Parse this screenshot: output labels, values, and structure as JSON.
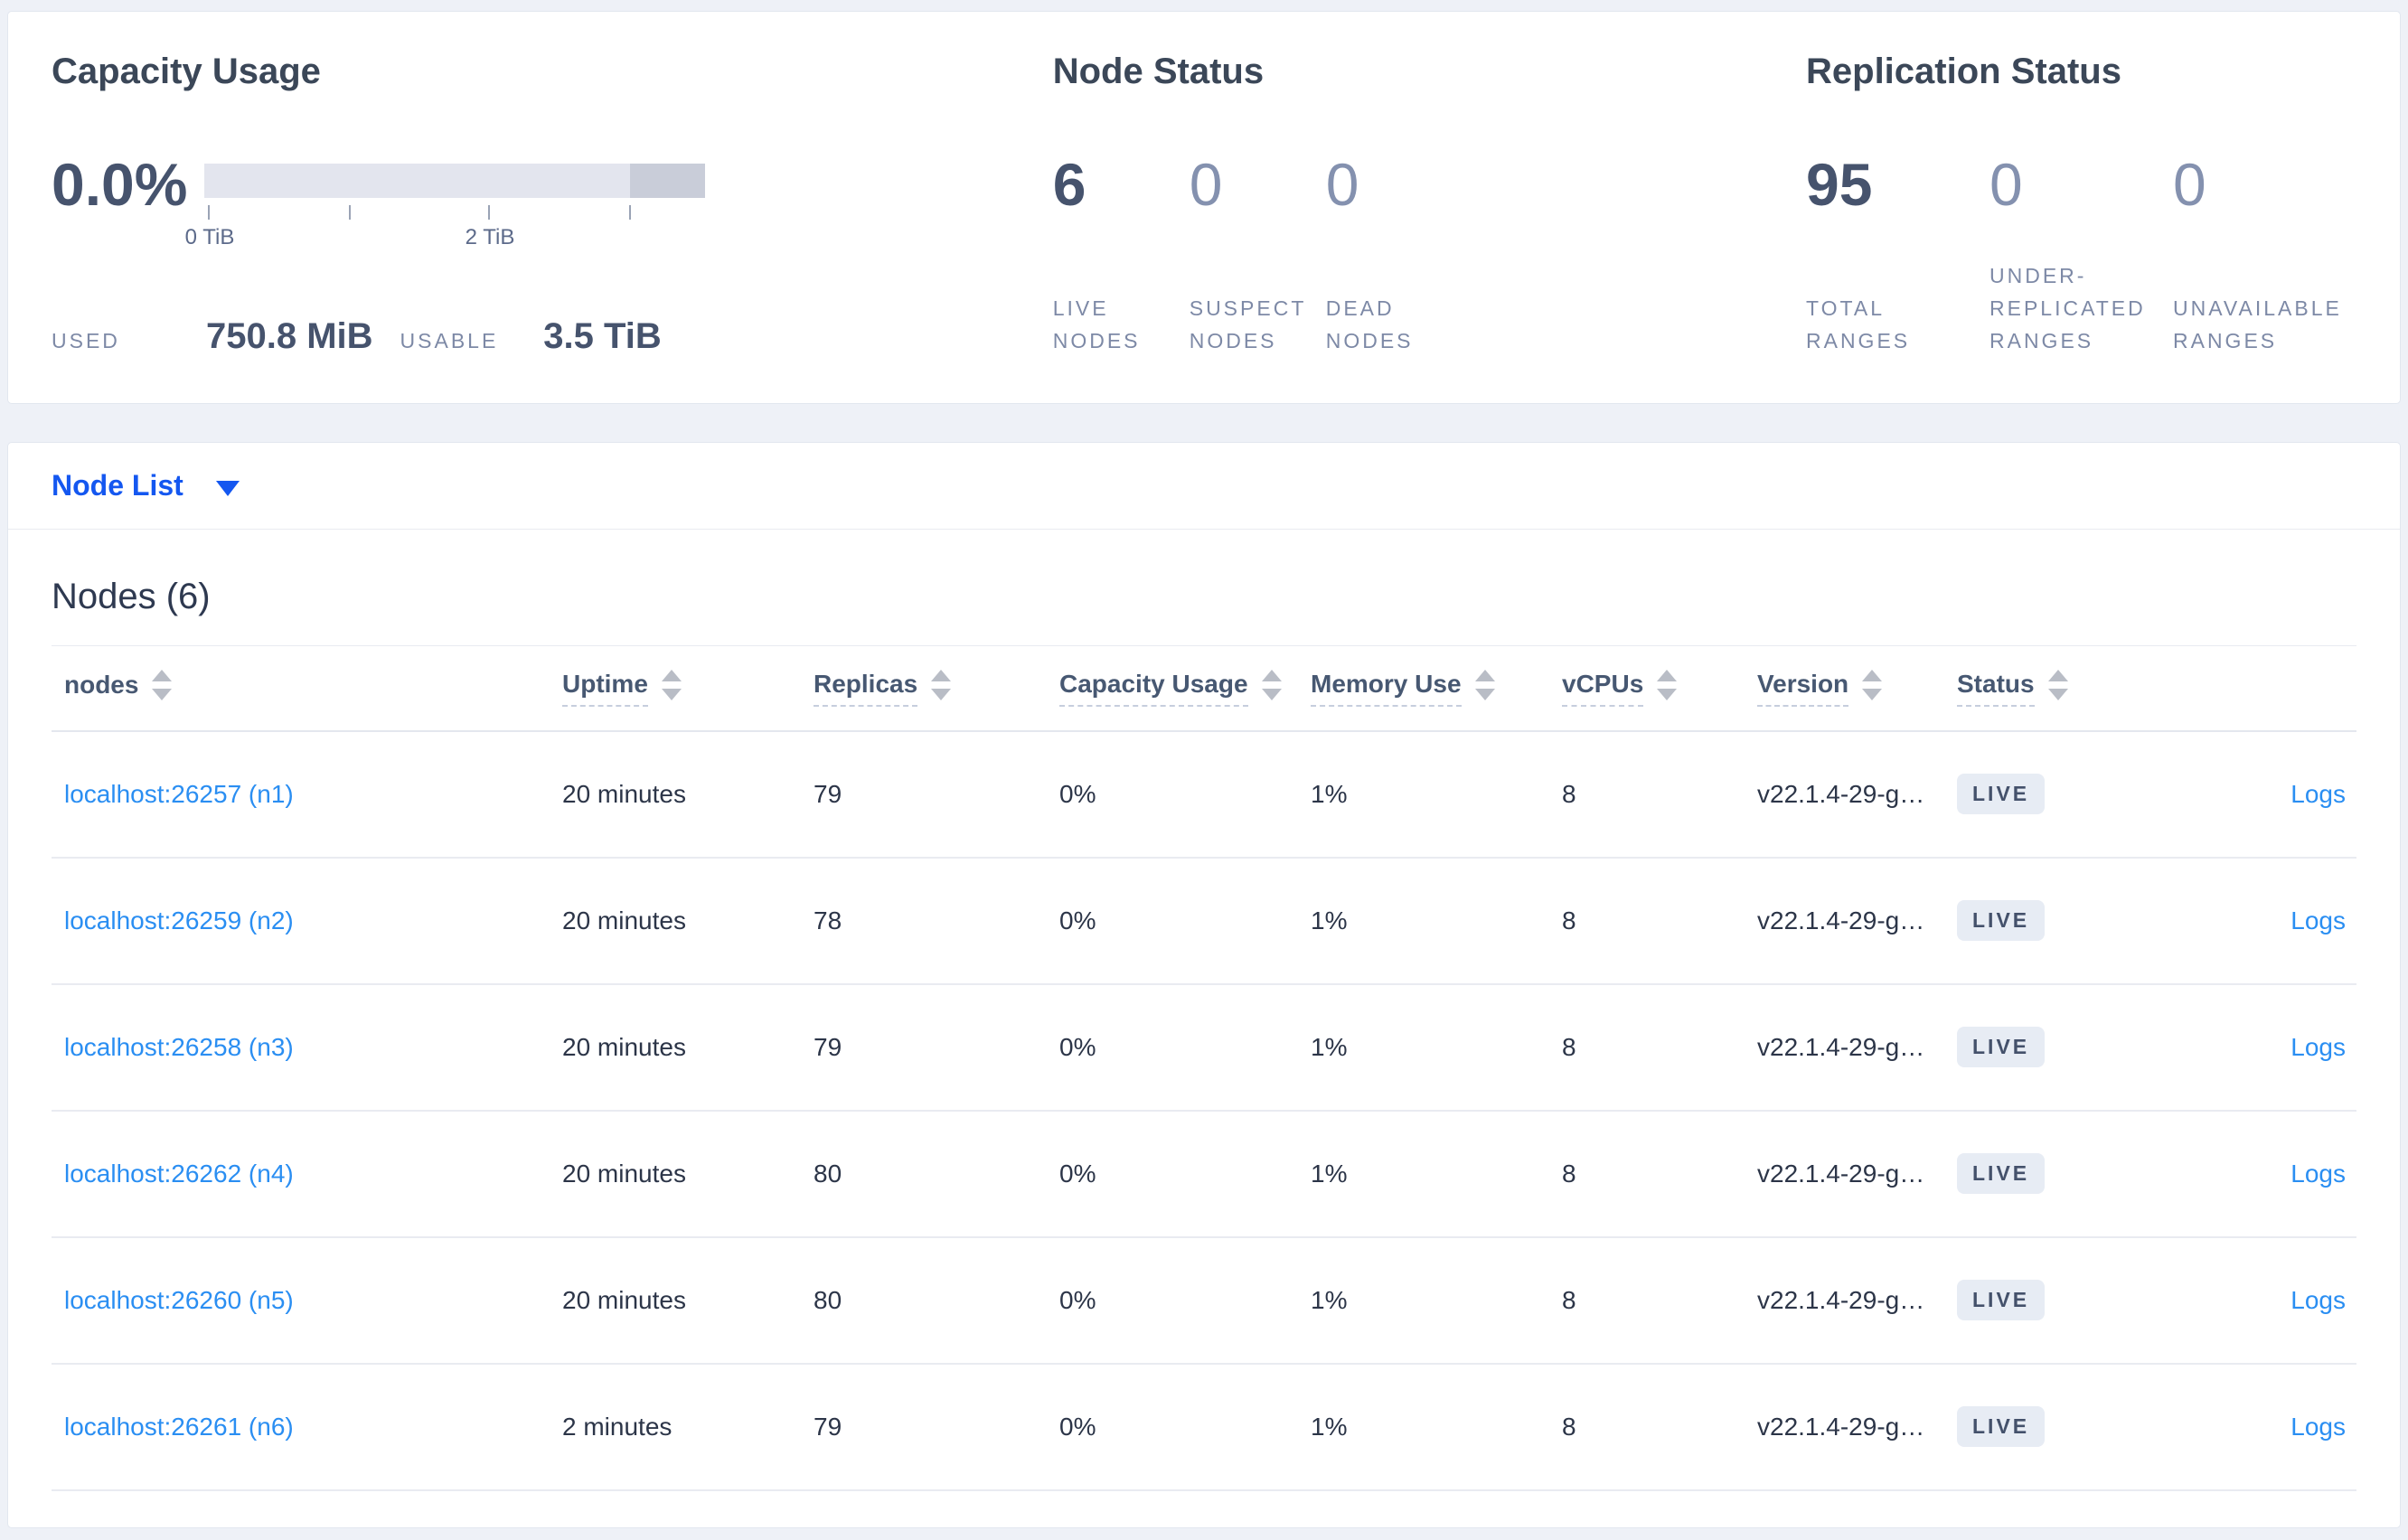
{
  "capacity_usage": {
    "title": "Capacity Usage",
    "percent": "0.0%",
    "axis_ticks": [
      "0 TiB",
      "2 TiB"
    ],
    "bar": {
      "used_fraction": 0.0,
      "dark_segment_start_fraction": 0.85,
      "total": "3.5 TiB"
    },
    "used_label": "USED",
    "used_value": "750.8 MiB",
    "usable_label": "USABLE",
    "usable_value": "3.5 TiB"
  },
  "node_status": {
    "title": "Node Status",
    "stats": [
      {
        "value": "6",
        "label": "LIVE NODES",
        "strong": true
      },
      {
        "value": "0",
        "label": "SUSPECT NODES",
        "strong": false
      },
      {
        "value": "0",
        "label": "DEAD NODES",
        "strong": false
      }
    ]
  },
  "replication_status": {
    "title": "Replication Status",
    "stats": [
      {
        "value": "95",
        "label": "TOTAL RANGES",
        "strong": true
      },
      {
        "value": "0",
        "label": "UNDER-REPLICATED RANGES",
        "strong": false
      },
      {
        "value": "0",
        "label": "UNAVAILABLE RANGES",
        "strong": false
      }
    ]
  },
  "node_list": {
    "label": "Node List"
  },
  "nodes_table": {
    "heading": "Nodes (6)",
    "columns": [
      {
        "key": "address",
        "label": "nodes",
        "underline": false,
        "sort": true
      },
      {
        "key": "uptime",
        "label": "Uptime",
        "underline": true,
        "sort": true
      },
      {
        "key": "replicas",
        "label": "Replicas",
        "underline": true,
        "sort": true
      },
      {
        "key": "capacity",
        "label": "Capacity Usage",
        "underline": true,
        "sort": true
      },
      {
        "key": "memory",
        "label": "Memory Use",
        "underline": true,
        "sort": true
      },
      {
        "key": "vcpus",
        "label": "vCPUs",
        "underline": true,
        "sort": true
      },
      {
        "key": "version",
        "label": "Version",
        "underline": true,
        "sort": true
      },
      {
        "key": "status",
        "label": "Status",
        "underline": true,
        "sort": true
      },
      {
        "key": "logs",
        "label": "",
        "underline": false,
        "sort": false
      }
    ],
    "rows": [
      {
        "address": "localhost:26257 (n1)",
        "uptime": "20 minutes",
        "replicas": "79",
        "capacity": "0%",
        "memory": "1%",
        "vcpus": "8",
        "version": "v22.1.4-29-g…",
        "status": "LIVE",
        "logs": "Logs"
      },
      {
        "address": "localhost:26259 (n2)",
        "uptime": "20 minutes",
        "replicas": "78",
        "capacity": "0%",
        "memory": "1%",
        "vcpus": "8",
        "version": "v22.1.4-29-g…",
        "status": "LIVE",
        "logs": "Logs"
      },
      {
        "address": "localhost:26258 (n3)",
        "uptime": "20 minutes",
        "replicas": "79",
        "capacity": "0%",
        "memory": "1%",
        "vcpus": "8",
        "version": "v22.1.4-29-g…",
        "status": "LIVE",
        "logs": "Logs"
      },
      {
        "address": "localhost:26262 (n4)",
        "uptime": "20 minutes",
        "replicas": "80",
        "capacity": "0%",
        "memory": "1%",
        "vcpus": "8",
        "version": "v22.1.4-29-g…",
        "status": "LIVE",
        "logs": "Logs"
      },
      {
        "address": "localhost:26260 (n5)",
        "uptime": "20 minutes",
        "replicas": "80",
        "capacity": "0%",
        "memory": "1%",
        "vcpus": "8",
        "version": "v22.1.4-29-g…",
        "status": "LIVE",
        "logs": "Logs"
      },
      {
        "address": "localhost:26261 (n6)",
        "uptime": "2 minutes",
        "replicas": "79",
        "capacity": "0%",
        "memory": "1%",
        "vcpus": "8",
        "version": "v22.1.4-29-g…",
        "status": "LIVE",
        "logs": "Logs"
      }
    ]
  },
  "colors": {
    "page_bg": "#eef1f7",
    "card_bg": "#ffffff",
    "card_border": "#e2e7ef",
    "heading": "#3b4758",
    "stat_strong": "#46536d",
    "stat_muted": "#8491af",
    "label_muted": "#7d89a6",
    "link_primary": "#1457f0",
    "link_table": "#2a8ef2",
    "bar_light": "#e3e5ee",
    "bar_dark": "#c9cdd9",
    "badge_bg": "#e7ecf4",
    "badge_text": "#44516b",
    "row_border": "#e9ebf1",
    "header_border": "#e4e7ee",
    "cell_text": "#2c3548",
    "header_text": "#475872",
    "sort_icon": "#b9bdc6",
    "tick": "#9aa3b5",
    "tick_label": "#5c6a8a"
  }
}
